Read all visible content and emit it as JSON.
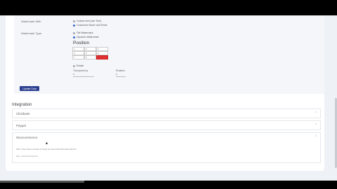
{
  "form": {
    "watermark_with": {
      "label": "Watermark With",
      "options": [
        {
          "label": "Custom text (use Text)",
          "selected": false
        },
        {
          "label": "Customize Name and Email",
          "selected": true
        }
      ]
    },
    "watermark_type": {
      "label": "Watermark Type",
      "options": [
        {
          "label": "Tile Watermark",
          "selected": false
        },
        {
          "label": "Dynamic Watermark",
          "selected": true
        }
      ]
    },
    "position": {
      "title": "Position",
      "cells": [
        "1",
        "2",
        "3",
        "4",
        "5",
        "6",
        "7",
        "8",
        ""
      ]
    },
    "rotate_label": "Rotate",
    "transparency": {
      "label": "Transparency",
      "value": "0"
    },
    "rotation": {
      "label": "Rotation",
      "value": "0"
    },
    "save_label": "Update Data"
  },
  "integration": {
    "title": "Integration",
    "sections": [
      {
        "label": "Clickbank"
      },
      {
        "label": "Paypal"
      },
      {
        "label": "Woocommerce"
      }
    ],
    "woocommerce_url": "URL: https://api.example.com/wp-json/wc/v3/webhooks/endpoint",
    "woocommerce_key": "Key: xxxxxxxxxxxxxxxx"
  },
  "colors": {
    "accent": "#2b3f8f",
    "selected_position": "#e03131"
  }
}
